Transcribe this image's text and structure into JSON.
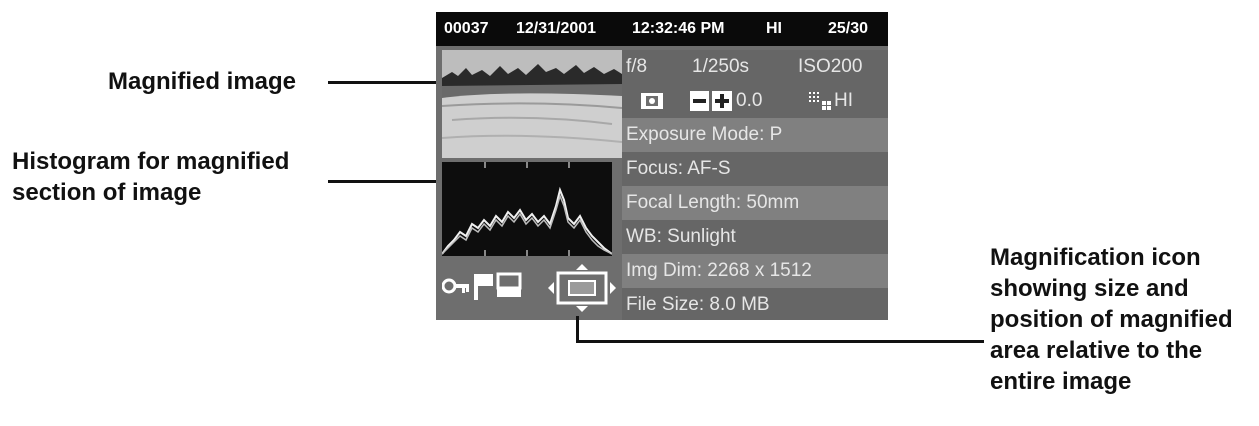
{
  "callouts": {
    "magnified_image": "Magnified image",
    "histogram": [
      "Histogram for magnified",
      "section of image"
    ],
    "magnification_icon": [
      "Magnification icon",
      "showing size and",
      "position of magnified",
      "area relative to the",
      "entire image"
    ]
  },
  "topbar": {
    "frame": "00037",
    "date": "12/31/2001",
    "time": "12:32:46 PM",
    "quality": "HI",
    "count": "25/30"
  },
  "info": {
    "aperture": "f/8",
    "shutter": "1/250s",
    "iso": "ISO200",
    "exp_comp": "0.0",
    "image_quality": "HI",
    "rows": [
      "Exposure Mode: P",
      "Focus: AF-S",
      "Focal Length: 50mm",
      "WB: Sunlight",
      "Img Dim: 2268 x 1512",
      "File Size: 8.0 MB"
    ]
  },
  "icons": [
    "lock-icon",
    "flag-icon",
    "print-icon",
    "magnification-navigator-icon"
  ]
}
